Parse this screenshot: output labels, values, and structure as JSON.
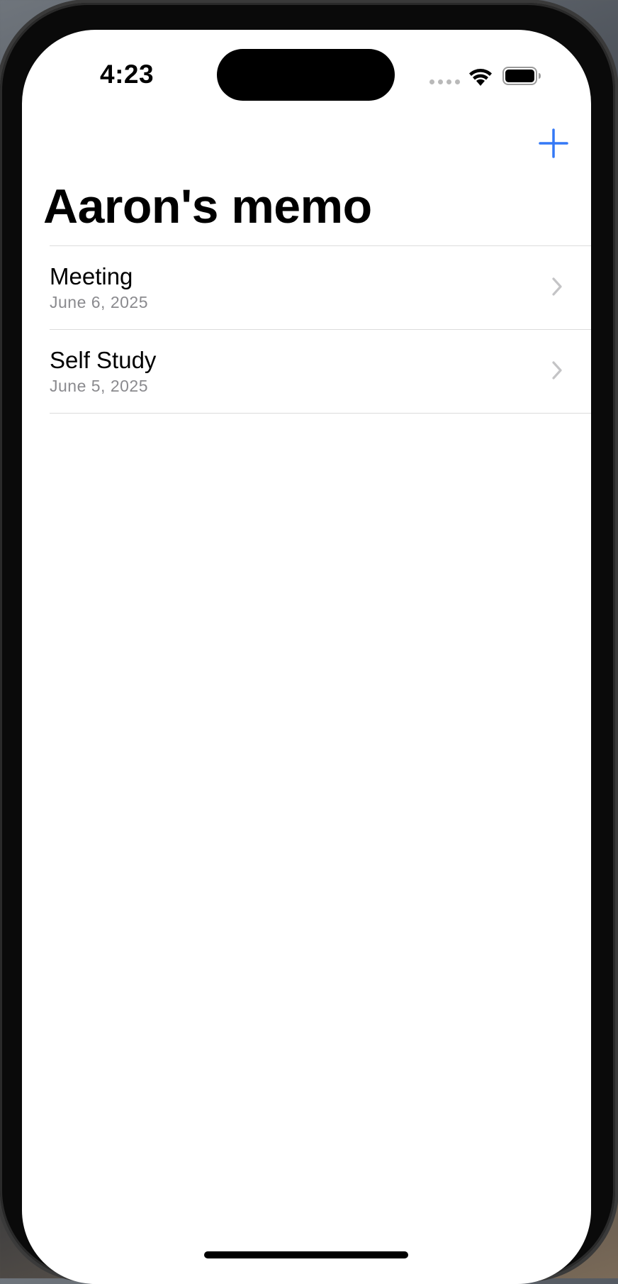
{
  "status_bar": {
    "time": "4:23"
  },
  "nav": {
    "title": "Aaron's memo",
    "add_icon": "plus-icon",
    "accent_color": "#3478f6"
  },
  "memos": [
    {
      "title": "Meeting",
      "date": "June 6, 2025"
    },
    {
      "title": "Self Study",
      "date": "June 5, 2025"
    }
  ]
}
